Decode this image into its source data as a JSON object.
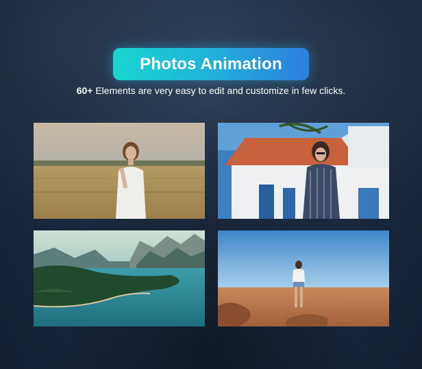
{
  "header": {
    "title": "Photos Animation",
    "subtitle_highlight": "60+",
    "subtitle_rest": " Elements are very easy to edit and customize in few clicks."
  },
  "photos": [
    {
      "name": "woman-in-wheat-field"
    },
    {
      "name": "woman-in-striped-suit-by-house"
    },
    {
      "name": "lake-and-mountains"
    },
    {
      "name": "woman-in-desert"
    }
  ],
  "colors": {
    "accent_start": "#19d6d0",
    "accent_end": "#2f7fe0",
    "background": "#1c2b40"
  }
}
